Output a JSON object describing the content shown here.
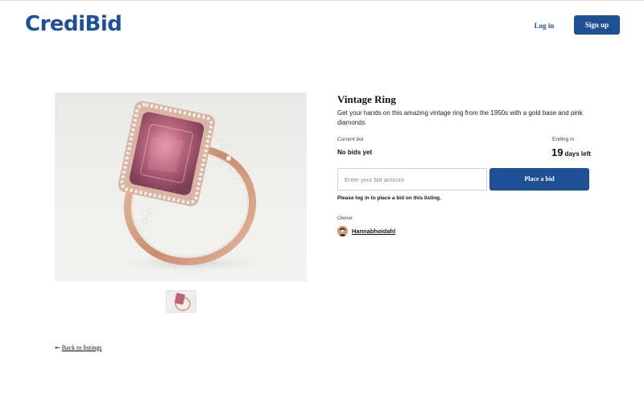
{
  "header": {
    "logo_text": "CrediBid",
    "login_label": "Log in",
    "signup_label": "Sign up"
  },
  "listing": {
    "title": "Vintage Ring",
    "description": "Get your hands on this amazing vintage ring from the 1950s with a gold base and pink diamonds",
    "current_bid_label": "Current bid",
    "current_bid_value": "No bids yet",
    "ending_label": "Ending in",
    "ending_number": "19",
    "ending_unit": "days left",
    "bid_input": {
      "value": "",
      "placeholder": "Enter your bid amount"
    },
    "place_bid_label": "Place a bid",
    "login_note": "Please log in to place a bid on this listing.",
    "owner_label": "Owner",
    "owner_name": "Hannabhoidahl"
  },
  "footer": {
    "back_arrow_icon": "arrow-left-icon",
    "back_label": "Back to listings"
  },
  "colors": {
    "brand": "#1f4f94",
    "gem": "#b9657e",
    "metal": "#d6a48a"
  }
}
